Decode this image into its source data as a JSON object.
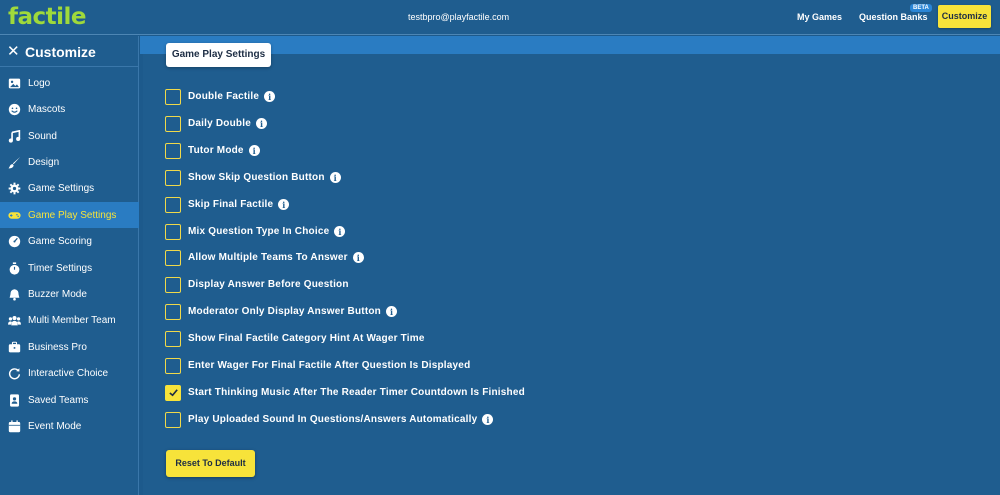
{
  "header": {
    "logo": "factile",
    "email": "testbpro@playfactile.com",
    "nav": {
      "my_games": "My Games",
      "question_banks": "Question Banks",
      "beta": "BETA",
      "customize": "Customize"
    }
  },
  "sidebar": {
    "title": "Customize",
    "items": [
      {
        "label": "Logo",
        "icon": "image-icon"
      },
      {
        "label": "Mascots",
        "icon": "smiley-icon"
      },
      {
        "label": "Sound",
        "icon": "music-note-icon"
      },
      {
        "label": "Design",
        "icon": "paintbrush-icon"
      },
      {
        "label": "Game Settings",
        "icon": "gear-icon"
      },
      {
        "label": "Game Play Settings",
        "icon": "gamepad-icon",
        "active": true
      },
      {
        "label": "Game Scoring",
        "icon": "gauge-icon"
      },
      {
        "label": "Timer Settings",
        "icon": "stopwatch-icon"
      },
      {
        "label": "Buzzer Mode",
        "icon": "bell-icon"
      },
      {
        "label": "Multi Member Team",
        "icon": "users-icon"
      },
      {
        "label": "Business Pro",
        "icon": "briefcase-icon"
      },
      {
        "label": "Interactive Choice",
        "icon": "refresh-icon"
      },
      {
        "label": "Saved Teams",
        "icon": "id-badge-icon"
      },
      {
        "label": "Event Mode",
        "icon": "calendar-icon"
      }
    ]
  },
  "main": {
    "section_title": "Game Play Settings",
    "settings": [
      {
        "label": "Double Factile",
        "checked": false,
        "info": true
      },
      {
        "label": "Daily Double",
        "checked": false,
        "info": true
      },
      {
        "label": "Tutor Mode",
        "checked": false,
        "info": true
      },
      {
        "label": "Show Skip Question Button",
        "checked": false,
        "info": true
      },
      {
        "label": "Skip Final Factile",
        "checked": false,
        "info": true
      },
      {
        "label": "Mix Question Type In Choice",
        "checked": false,
        "info": true
      },
      {
        "label": "Allow Multiple Teams To Answer",
        "checked": false,
        "info": true
      },
      {
        "label": "Display Answer Before Question",
        "checked": false,
        "info": false
      },
      {
        "label": "Moderator Only Display Answer Button",
        "checked": false,
        "info": true
      },
      {
        "label": "Show Final Factile Category Hint At Wager Time",
        "checked": false,
        "info": false
      },
      {
        "label": "Enter Wager For Final Factile After Question Is Displayed",
        "checked": false,
        "info": false
      },
      {
        "label": "Start Thinking Music After The Reader Timer Countdown Is Finished",
        "checked": true,
        "info": false
      },
      {
        "label": "Play Uploaded Sound In Questions/Answers Automatically",
        "checked": false,
        "info": true
      }
    ],
    "reset_label": "Reset To Default",
    "info_glyph": "i"
  },
  "colors": {
    "background": "#1f5d8f",
    "accent": "#f7e33a",
    "logo": "#9fd93b",
    "active_item": "#2a7cc2"
  }
}
